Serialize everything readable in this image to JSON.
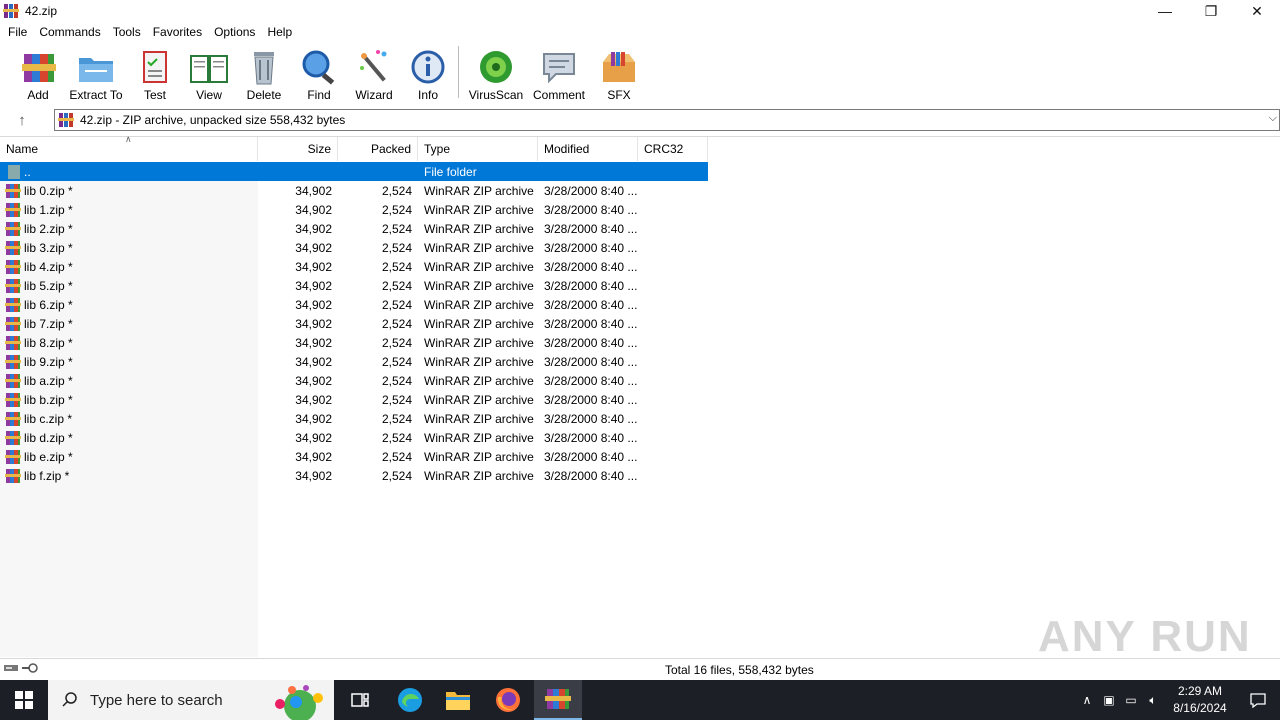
{
  "window": {
    "title": "42.zip"
  },
  "menu": [
    "File",
    "Commands",
    "Tools",
    "Favorites",
    "Options",
    "Help"
  ],
  "toolbar": [
    {
      "label": "Add",
      "icon": "add-archive-icon"
    },
    {
      "label": "Extract To",
      "icon": "extract-to-icon"
    },
    {
      "label": "Test",
      "icon": "test-icon"
    },
    {
      "label": "View",
      "icon": "view-icon"
    },
    {
      "label": "Delete",
      "icon": "delete-icon"
    },
    {
      "label": "Find",
      "icon": "find-icon"
    },
    {
      "label": "Wizard",
      "icon": "wizard-icon"
    },
    {
      "label": "Info",
      "icon": "info-icon"
    },
    {
      "label": "VirusScan",
      "icon": "virusscan-icon"
    },
    {
      "label": "Comment",
      "icon": "comment-icon"
    },
    {
      "label": "SFX",
      "icon": "sfx-icon"
    }
  ],
  "address": {
    "text": "42.zip - ZIP archive, unpacked size 558,432 bytes"
  },
  "columns": {
    "name": "Name",
    "size": "Size",
    "packed": "Packed",
    "type": "Type",
    "modified": "Modified",
    "crc": "CRC32"
  },
  "parent_row": {
    "name": "..",
    "type": "File folder"
  },
  "files": [
    {
      "name": "lib 0.zip *",
      "size": "34,902",
      "packed": "2,524",
      "type": "WinRAR ZIP archive",
      "modified": "3/28/2000 8:40 ..."
    },
    {
      "name": "lib 1.zip *",
      "size": "34,902",
      "packed": "2,524",
      "type": "WinRAR ZIP archive",
      "modified": "3/28/2000 8:40 ..."
    },
    {
      "name": "lib 2.zip *",
      "size": "34,902",
      "packed": "2,524",
      "type": "WinRAR ZIP archive",
      "modified": "3/28/2000 8:40 ..."
    },
    {
      "name": "lib 3.zip *",
      "size": "34,902",
      "packed": "2,524",
      "type": "WinRAR ZIP archive",
      "modified": "3/28/2000 8:40 ..."
    },
    {
      "name": "lib 4.zip *",
      "size": "34,902",
      "packed": "2,524",
      "type": "WinRAR ZIP archive",
      "modified": "3/28/2000 8:40 ..."
    },
    {
      "name": "lib 5.zip *",
      "size": "34,902",
      "packed": "2,524",
      "type": "WinRAR ZIP archive",
      "modified": "3/28/2000 8:40 ..."
    },
    {
      "name": "lib 6.zip *",
      "size": "34,902",
      "packed": "2,524",
      "type": "WinRAR ZIP archive",
      "modified": "3/28/2000 8:40 ..."
    },
    {
      "name": "lib 7.zip *",
      "size": "34,902",
      "packed": "2,524",
      "type": "WinRAR ZIP archive",
      "modified": "3/28/2000 8:40 ..."
    },
    {
      "name": "lib 8.zip *",
      "size": "34,902",
      "packed": "2,524",
      "type": "WinRAR ZIP archive",
      "modified": "3/28/2000 8:40 ..."
    },
    {
      "name": "lib 9.zip *",
      "size": "34,902",
      "packed": "2,524",
      "type": "WinRAR ZIP archive",
      "modified": "3/28/2000 8:40 ..."
    },
    {
      "name": "lib a.zip *",
      "size": "34,902",
      "packed": "2,524",
      "type": "WinRAR ZIP archive",
      "modified": "3/28/2000 8:40 ..."
    },
    {
      "name": "lib b.zip *",
      "size": "34,902",
      "packed": "2,524",
      "type": "WinRAR ZIP archive",
      "modified": "3/28/2000 8:40 ..."
    },
    {
      "name": "lib c.zip *",
      "size": "34,902",
      "packed": "2,524",
      "type": "WinRAR ZIP archive",
      "modified": "3/28/2000 8:40 ..."
    },
    {
      "name": "lib d.zip *",
      "size": "34,902",
      "packed": "2,524",
      "type": "WinRAR ZIP archive",
      "modified": "3/28/2000 8:40 ..."
    },
    {
      "name": "lib e.zip *",
      "size": "34,902",
      "packed": "2,524",
      "type": "WinRAR ZIP archive",
      "modified": "3/28/2000 8:40 ..."
    },
    {
      "name": "lib f.zip *",
      "size": "34,902",
      "packed": "2,524",
      "type": "WinRAR ZIP archive",
      "modified": "3/28/2000 8:40 ..."
    }
  ],
  "status": {
    "text": "Total 16 files, 558,432 bytes"
  },
  "watermark": "ANY RUN",
  "taskbar": {
    "search_placeholder": "Type here to search",
    "time": "2:29 AM",
    "date": "8/16/2024"
  },
  "colors": {
    "selection": "#0078d7",
    "taskbar": "#1c1f26"
  }
}
